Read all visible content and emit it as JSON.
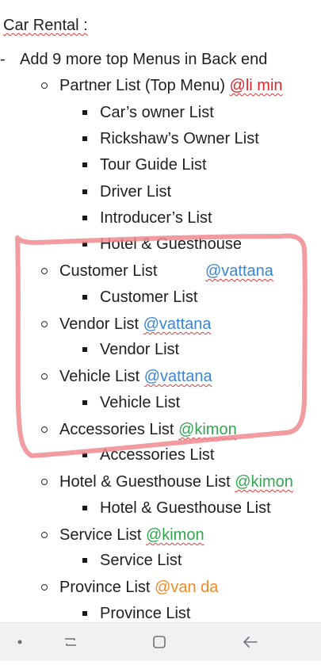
{
  "document": {
    "title": "Car Rental :",
    "main_item": "Add 9 more top Menus in Back end",
    "sections": [
      {
        "label": "Partner List (Top Menu) ",
        "mention": "@li min",
        "mention_color": "#e0262a",
        "children": [
          "Car’s owner List",
          "Rickshaw’s Owner List",
          "Tour Guide List",
          "Driver List",
          "Introducer’s List",
          "Hotel & Guesthouse"
        ]
      },
      {
        "label": "Customer List",
        "mention": "@vattana",
        "mention_color": "#3a86d6",
        "children": [
          "Customer List"
        ]
      },
      {
        "label": "Vendor List ",
        "mention": "@vattana",
        "mention_color": "#3a86d6",
        "children": [
          "Vendor List"
        ]
      },
      {
        "label": "Vehicle List ",
        "mention": "@vattana",
        "mention_color": "#3a86d6",
        "children": [
          "Vehicle List"
        ]
      },
      {
        "label": "Accessories List ",
        "mention": "@kimon",
        "mention_color": "#2fa84f",
        "children": [
          "Accessories List"
        ]
      },
      {
        "label": "Hotel & Guesthouse List ",
        "mention": "@kimon",
        "mention_color": "#2fa84f",
        "children": [
          "Hotel & Guesthouse List"
        ]
      },
      {
        "label": "Service List ",
        "mention": "@kimon",
        "mention_color": "#2fa84f",
        "children": [
          "Service List"
        ]
      },
      {
        "label": "Province List ",
        "mention": "@van da",
        "mention_color": "#f08a24",
        "children": [
          "Province List"
        ]
      }
    ]
  },
  "annotation": {
    "color": "#f08a8f"
  },
  "navbar": {
    "icons": [
      "dot-icon",
      "recent-apps-icon",
      "home-icon",
      "back-icon"
    ]
  }
}
